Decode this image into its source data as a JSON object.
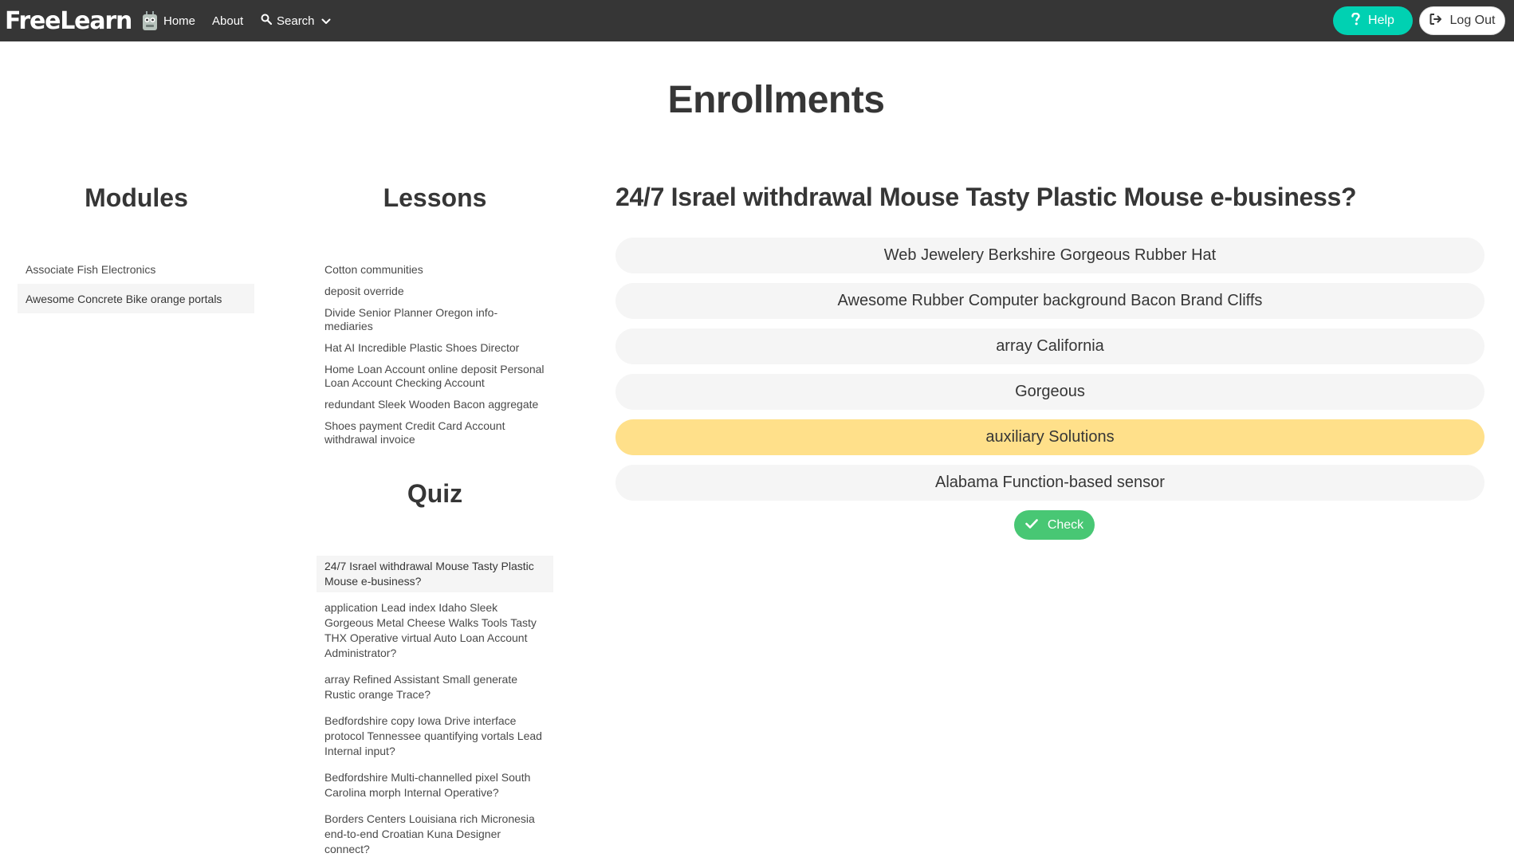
{
  "navbar": {
    "brand": "FreeLearn",
    "home": "Home",
    "about": "About",
    "search": "Search",
    "help": "Help",
    "logout": "Log Out",
    "icons": {
      "logo": "robot-icon",
      "search": "search-icon",
      "search_dropdown": "chevron-down-icon",
      "help": "question-icon",
      "logout": "sign-out-icon"
    },
    "colors": {
      "bar": "#363636",
      "help": "#00d1b2"
    }
  },
  "page": {
    "title": "Enrollments"
  },
  "modules": {
    "title": "Modules",
    "items": [
      {
        "label": "Associate Fish Electronics",
        "active": false
      },
      {
        "label": "Awesome Concrete Bike orange portals",
        "active": true
      }
    ]
  },
  "lessons": {
    "title": "Lessons",
    "items": [
      "Cotton communities",
      "deposit override",
      "Divide Senior Planner Oregon info-mediaries",
      "Hat AI Incredible Plastic Shoes Director",
      "Home Loan Account online deposit Personal Loan Account Checking Account",
      "redundant Sleek Wooden Bacon aggregate",
      "Shoes payment Credit Card Account withdrawal invoice"
    ]
  },
  "quiz": {
    "title": "Quiz",
    "items": [
      {
        "label": "24/7 Israel withdrawal Mouse Tasty Plastic Mouse e-business?",
        "active": true
      },
      {
        "label": "application Lead index Idaho Sleek Gorgeous Metal Cheese Walks Tools Tasty THX Operative virtual Auto Loan Account Administrator?",
        "active": false
      },
      {
        "label": "array Refined Assistant Small generate Rustic orange Trace?",
        "active": false
      },
      {
        "label": "Bedfordshire copy Iowa Drive interface protocol Tennessee quantifying vortals Lead Internal input?",
        "active": false
      },
      {
        "label": "Bedfordshire Multi-channelled pixel South Carolina morph Internal Operative?",
        "active": false
      },
      {
        "label": "Borders Centers Louisiana rich Micronesia end-to-end Croatian Kuna Designer connect?",
        "active": false
      }
    ]
  },
  "question": {
    "text": "24/7 Israel withdrawal Mouse Tasty Plastic Mouse e-business?",
    "answers": [
      {
        "label": "Web Jewelery Berkshire Gorgeous Rubber Hat",
        "selected": false
      },
      {
        "label": "Awesome Rubber Computer background Bacon Brand Cliffs",
        "selected": false
      },
      {
        "label": "array California",
        "selected": false
      },
      {
        "label": "Gorgeous",
        "selected": false
      },
      {
        "label": "auxiliary Solutions",
        "selected": true
      },
      {
        "label": "Alabama Function-based sensor",
        "selected": false
      }
    ],
    "check_label": "Check",
    "check_icon": "check-icon",
    "colors": {
      "selected": "#ffe08a",
      "check": "#48c774"
    }
  }
}
